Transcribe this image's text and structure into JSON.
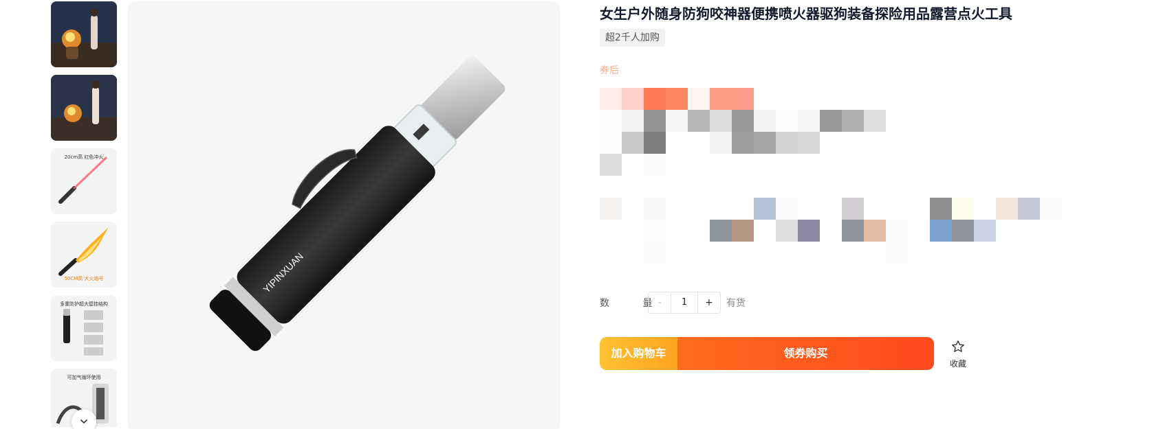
{
  "product": {
    "title": "女生户外随身防狗咬神器便携喷火器驱狗装备探险用品露营点火工具",
    "sales_text": "超2千人加购",
    "coupon_label": "券后"
  },
  "main_image": {
    "brand_text": "YIPINXUAN"
  },
  "thumbnails": [
    {
      "caption": ""
    },
    {
      "caption": ""
    },
    {
      "caption": "20cm高 红色冲火"
    },
    {
      "caption": "50CM高 大火焰号"
    },
    {
      "caption": "多重防护超大壁挂结构"
    },
    {
      "caption": "可加气循环使用"
    }
  ],
  "quantity": {
    "label": "数 量",
    "minus": "-",
    "value": "1",
    "plus": "+",
    "stock": "有货"
  },
  "actions": {
    "cart": "加入购物车",
    "buy": "领券购买",
    "favorite": "收藏"
  },
  "icons": {
    "scroll": "chevron-down-icon",
    "favorite": "star-outline-icon"
  },
  "colors": {
    "cart_start": "#ffc233",
    "buy_end": "#ff4a1d",
    "title": "#11192d"
  }
}
